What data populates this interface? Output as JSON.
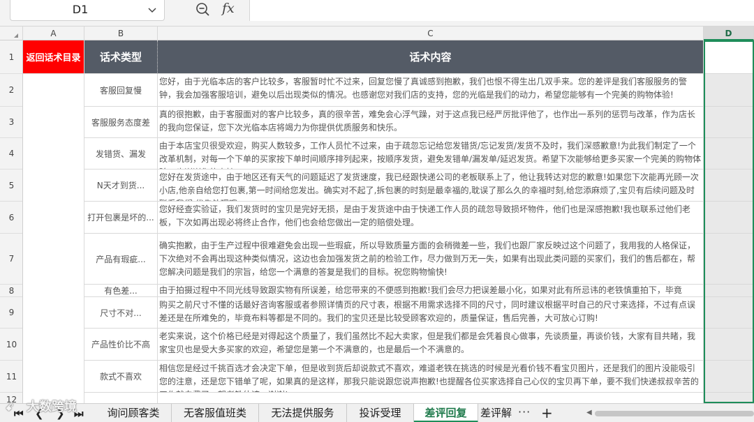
{
  "formula_bar": {
    "name_box": "D1",
    "zoom_icon": "zoom-out-icon",
    "fx_label": "fx",
    "formula_value": ""
  },
  "columns": [
    "A",
    "B",
    "C",
    "D"
  ],
  "selected_column": "D",
  "rows": [
    "1",
    "2",
    "3",
    "4",
    "5",
    "6",
    "7",
    "8",
    "9",
    "10",
    "11",
    "12"
  ],
  "header": {
    "a1": "返回话术目录",
    "b1": "话术类型",
    "c1": "话术内容"
  },
  "table": [
    {
      "type": "客服回复慢",
      "content": "您好，由于光临本店的客户比较多，客服暂时忙不过来，回复您慢了真诚感到抱歉，我们也恨不得生出几双手来。您的差评是我们客服服务的警钟，我会加强客服培训，避免以后出现类似的情况。也感谢您对我们店的支持，您的光临是我们的动力，希望您能够有一个完美的购物体验!"
    },
    {
      "type": "客服服务态度差",
      "content": "真的很抱歉，由于客服面对的客户比较多，真的很辛苦，难免会心浮气躁，对于这点我已经严厉批评他了，也作出一系列的惩罚与改革，作为店长的我向您保证，您下次光临本店将竭力为你提供优质服务和快乐。"
    },
    {
      "type": "发错货、漏发",
      "content": "由于本店宝贝很受欢迎，购买人数较多，工作人员忙不过来，由于疏忽忘记给您发错货/忘记发货/发货不及时，我们深感歉意!为此我们制定了一个改革机制，对每一个下单的买家按下单时间顺序排列起来，按顺序发货，避免发错单/漏发单/延迟发货。希望下次能够给更多买家一个完美的购物体验，也谢谢您的支持!"
    },
    {
      "type": "N天才到货...",
      "content": "您好在发货途中，由于地区还有天气的问题延迟了发货速度，我已经跟快递公司的老板联系上了，他让我转达对您的歉意!如果您下次能再光顾一次小店,他亲自给您打包裹,第一时间给您发出。确实对不起了,拆包裹的时刻是最幸福的,耽误了那么久的幸福时刻,给您添麻烦了,宝贝有后续问题及时联系我们,优先处理哦。"
    },
    {
      "type": "打开包裹是坏的...",
      "content": "您好经查实验证，我们发货时的宝贝是完好无损，是由于发货途中由于快递工作人员的疏忽导致损坏物件，他们也是深感抱歉!我也联系过他们老板，下次如再出现必将终止合作，他们也会给您做出一定的赔偿处理。"
    },
    {
      "type": "产品有瑕疵...",
      "content": "确实抱歉，由于生产过程中很难避免会出现一些瑕疵，所以导致质量方面的会稍微差一些，我们也跟厂家反映过这个问题了，我用我的人格保证，下次绝对不会再出现这种类似情况，这边也会加强发货之前的检验工作，尽力做到万无一失，如果有出现此类问题的买家们，我们的售后都在，帮您解决问题是我们的宗旨，给您一个满意的答复是我们的目标。祝您购物愉快!"
    },
    {
      "type": "有色差...",
      "content": "由于拍摄过程中不同光线导致跟实物有所误差，给您带来的不便感到抱歉!我们会尽力把误差最小化，如果对此有所忌讳的老铁慎重拍下，毕竟"
    },
    {
      "type": "尺寸不对...",
      "content": "购买之前尺寸不懂的话最好咨询客服或者参照详情页的尺寸表，根据不用需求选择不同的尺寸，同时建议根据平时自己的尺寸来选择，不过有点误差还是在所难免的，毕竟布料等都是不同的。我们的宝贝还是比较受顾客欢迎的，质量保证，售后完善，大可放心订购!"
    },
    {
      "type": "产品性价比不高",
      "content": "老实来说，这个价格已经是对得起这个质量了，我们虽然比不起大卖家，但是我们都是会凭着良心做事，先谈质量，再谈价钱，大家有目共睹，我家宝贝也是受大多买家的欢迎，希望您是第一个不满意的，也是最后一个不满意的。"
    },
    {
      "type": "款式不喜欢",
      "content": "相信您是经过千挑百选才会决定下单，但是收到货后却说款式不喜欢，难道老铁在挑选的时候是光看价钱不看宝贝图片，还是我们的图片没能吸引您的注意，还是您下错单了呢，如果真的是这样，那我只能说跟您说声抱歉!也提醒各位买家选择自己心仪的宝贝再下单，要不我们快递叔叔辛苦的工作就白费了，望老铁体谅，谢谢!"
    }
  ],
  "sheet_nav": {
    "first": "⏮",
    "prev": "❮",
    "next": "❯",
    "last": "⏭"
  },
  "sheets": [
    "询问顾客类",
    "无客服值班类",
    "无法提供服务",
    "投诉受理",
    "差评回复",
    "差评解"
  ],
  "active_sheet": "差评回复",
  "more_tabs": "···",
  "add_sheet": "+",
  "watermark": "大数跨境"
}
